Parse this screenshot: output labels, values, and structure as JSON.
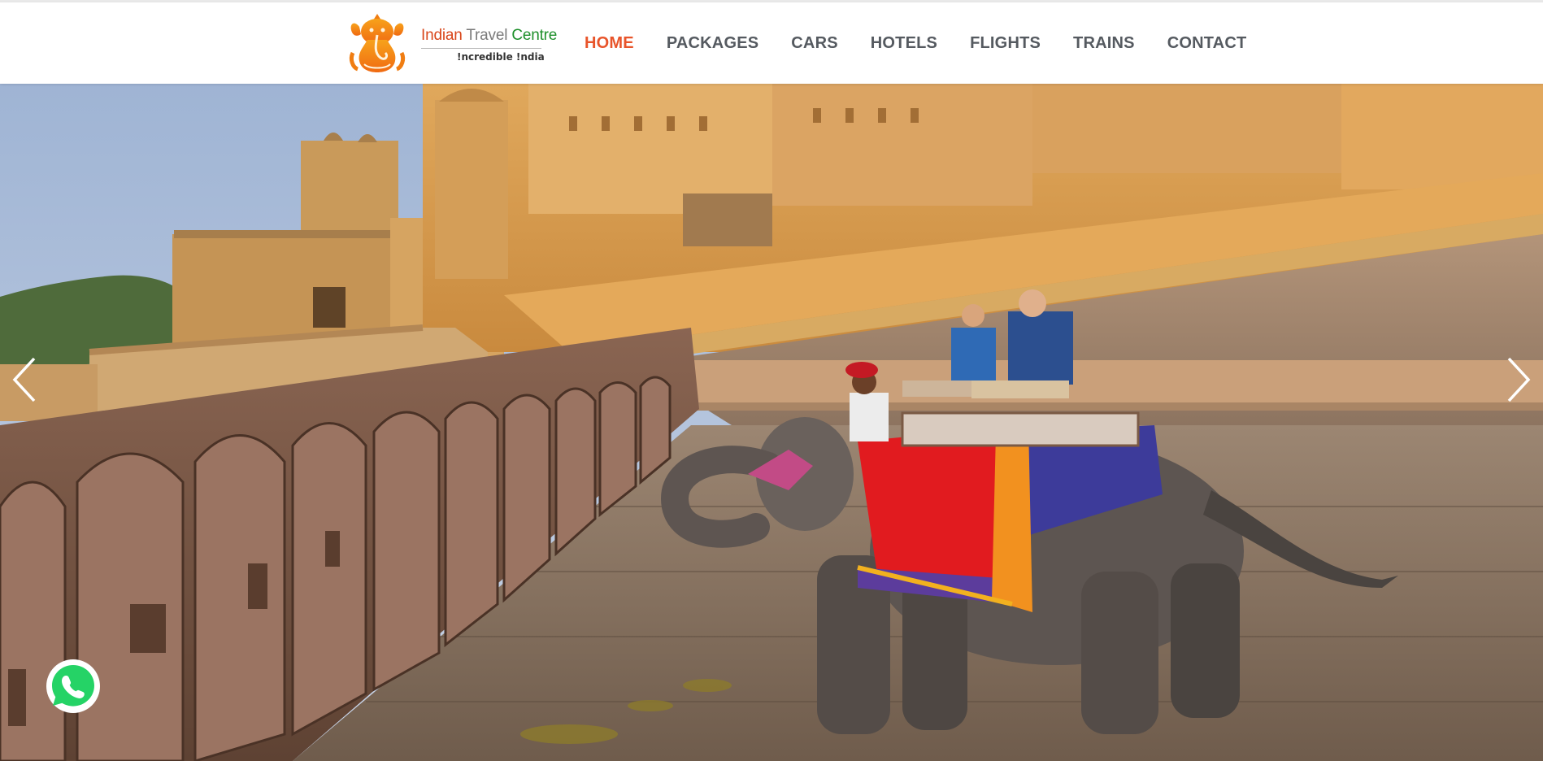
{
  "brand": {
    "name_part1": "Indian",
    "name_part2": "Travel",
    "name_part3": "Centre",
    "tagline": "!ncredible !ndia",
    "logo_icon": "ganesha-icon"
  },
  "nav": {
    "items": [
      {
        "label": "HOME",
        "active": true
      },
      {
        "label": "PACKAGES",
        "active": false
      },
      {
        "label": "CARS",
        "active": false
      },
      {
        "label": "HOTELS",
        "active": false
      },
      {
        "label": "FLIGHTS",
        "active": false
      },
      {
        "label": "TRAINS",
        "active": false
      },
      {
        "label": "CONTACT",
        "active": false
      }
    ]
  },
  "hero": {
    "image": "Amber Fort elephant ride slide",
    "prev_icon": "chevron-left-icon",
    "next_icon": "chevron-right-icon"
  },
  "whatsapp": {
    "icon": "whatsapp-icon"
  },
  "colors": {
    "nav_active": "#e8542a",
    "nav_text": "#555a60",
    "brand_red": "#d8461a",
    "brand_green": "#1d8f2a",
    "whatsapp_green": "#25d366"
  }
}
